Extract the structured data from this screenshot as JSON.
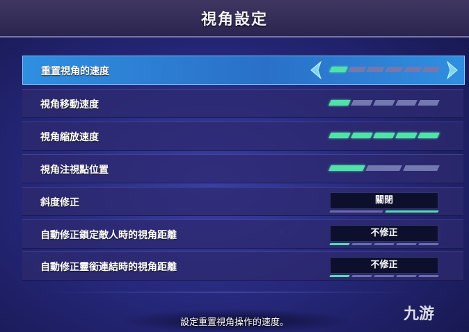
{
  "header": {
    "title": "視角設定"
  },
  "rows": [
    {
      "label": "重置視角的速度",
      "type": "slider",
      "segments": 6,
      "filled": 1,
      "selected": true
    },
    {
      "label": "視角移動速度",
      "type": "slider",
      "segments": 5,
      "filled": 1,
      "selected": false
    },
    {
      "label": "視角縮放速度",
      "type": "slider",
      "segments": 5,
      "filled": 5,
      "selected": false
    },
    {
      "label": "視角注視點位置",
      "type": "slider",
      "segments": 3,
      "filled": 1,
      "selected": false
    },
    {
      "label": "斜度修正",
      "type": "option",
      "value": "關閉",
      "option_count": 2,
      "option_index": 1
    },
    {
      "label": "自動修正鎖定敵人時的視角距離",
      "type": "option",
      "value": "不修正",
      "option_count": 5,
      "option_index": 0
    },
    {
      "label": "自動修正靈銜連結時的視角距離",
      "type": "option",
      "value": "不修正",
      "option_count": 5,
      "option_index": 0
    }
  ],
  "help_text": "設定重置視角操作的速度。",
  "watermark": "九游",
  "colors": {
    "accent": "#4fe3a8",
    "selected_row": "#2f8fe0",
    "segment_off": "#7378b0"
  },
  "icons": {
    "left": "chevron-left-icon",
    "right": "chevron-right-icon"
  }
}
